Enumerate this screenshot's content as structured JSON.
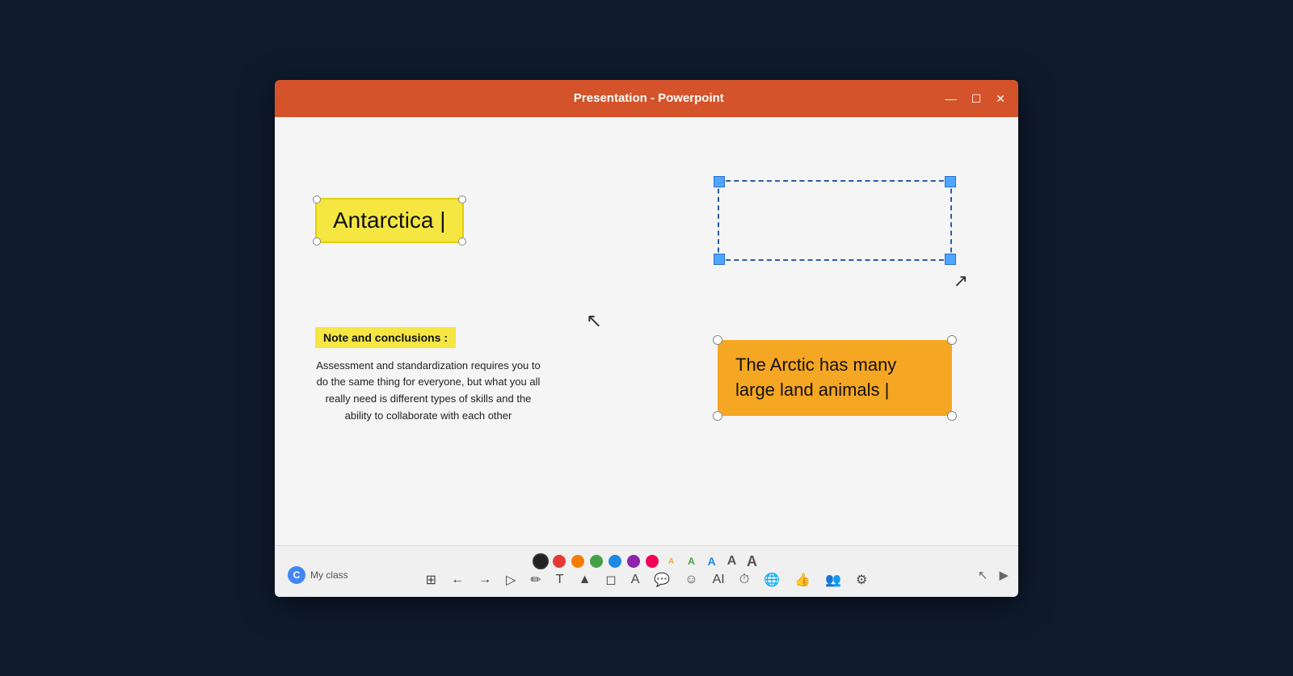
{
  "window": {
    "title": "Presentation - Powerpoint",
    "controls": {
      "minimize": "—",
      "maximize": "☐",
      "close": "✕"
    }
  },
  "slide": {
    "antarctica_label": "Antarctica |",
    "notes_label": "Note and conclusions :",
    "notes_text": "Assessment and standardization requires you to do the same thing for everyone, but what you all really need is different types of skills and the ability to collaborate with each other",
    "arctic_label": "The Arctic has many large land animals |"
  },
  "toolbar": {
    "brand_label": "My class",
    "colors": [
      {
        "color": "#222222",
        "active": true
      },
      {
        "color": "#e53935",
        "active": false
      },
      {
        "color": "#f57c00",
        "active": false
      },
      {
        "color": "#43a047",
        "active": false
      },
      {
        "color": "#1e88e5",
        "active": false
      },
      {
        "color": "#8e24aa",
        "active": false
      },
      {
        "color": "#f50057",
        "active": false
      }
    ],
    "text_sizes": [
      "A",
      "A",
      "A",
      "A",
      "A"
    ]
  }
}
